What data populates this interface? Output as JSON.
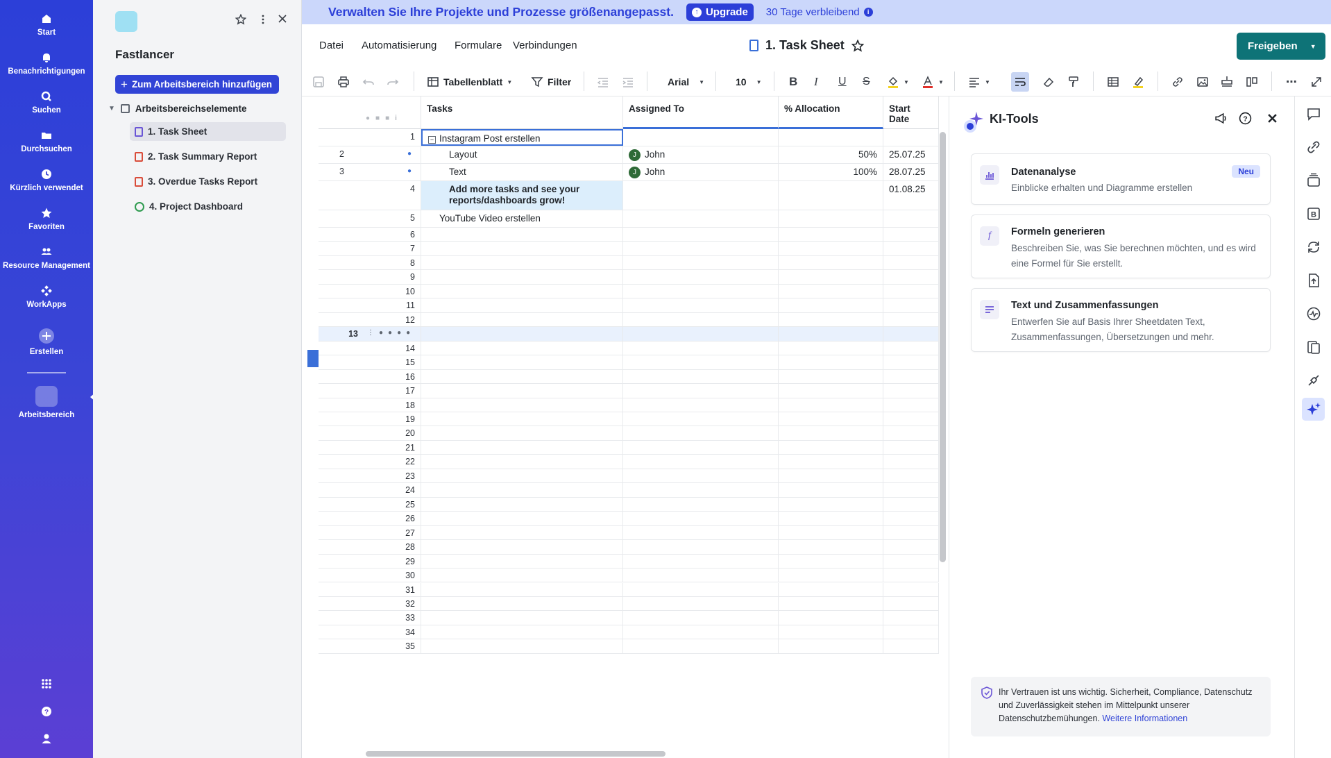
{
  "nav": {
    "items": [
      {
        "label": "Start",
        "icon": "home-icon"
      },
      {
        "label": "Benachrichtigungen",
        "icon": "bell-icon"
      },
      {
        "label": "Suchen",
        "icon": "search-icon"
      },
      {
        "label": "Durchsuchen",
        "icon": "folder-icon"
      },
      {
        "label": "Kürzlich verwendet",
        "icon": "clock-icon"
      },
      {
        "label": "Favoriten",
        "icon": "star-icon"
      },
      {
        "label": "Resource Management",
        "icon": "people-icon"
      },
      {
        "label": "WorkApps",
        "icon": "workapps-icon"
      },
      {
        "label": "Erstellen",
        "icon": "plus-circle-icon"
      }
    ],
    "workspace_label": "Arbeitsbereich"
  },
  "workspace": {
    "title": "Fastlancer",
    "add_button": "Zum Arbeitsbereich hinzufügen",
    "tree_head": "Arbeitsbereichselemente",
    "items": [
      {
        "label": "1. Task Sheet",
        "color": "#6a55d6"
      },
      {
        "label": "2. Task Summary Report",
        "color": "#d94c3a"
      },
      {
        "label": "3. Overdue Tasks Report",
        "color": "#d94c3a"
      },
      {
        "label": "4. Project Dashboard",
        "color": "#2e9b4f"
      }
    ]
  },
  "banner": {
    "text": "Verwalten Sie Ihre Projekte und Prozesse größenangepasst.",
    "upgrade": "Upgrade",
    "days": "30 Tage verbleibend"
  },
  "menu": {
    "items": [
      "Datei",
      "Automatisierung",
      "Formulare",
      "Verbindungen"
    ],
    "sheet_title": "1. Task Sheet",
    "share": "Freigeben"
  },
  "toolbar": {
    "view": "Tabellenblatt",
    "filter": "Filter",
    "font": "Arial",
    "size": "10"
  },
  "grid": {
    "columns": [
      "Tasks",
      "Assigned To",
      "% Allocation",
      "Start Date"
    ],
    "rows": [
      {
        "n": "1",
        "task": "Instagram Post erstellen",
        "assigned": "",
        "alloc": "",
        "start": ""
      },
      {
        "n": "2",
        "task": "Layout",
        "assigned": "John",
        "alloc": "50%",
        "start": "25.07.25"
      },
      {
        "n": "3",
        "task": "Text",
        "assigned": "John",
        "alloc": "100%",
        "start": "28.07.25"
      },
      {
        "n": "4",
        "task": "Add more tasks and see your reports/dashboards grow!",
        "assigned": "",
        "alloc": "",
        "start": "01.08.25"
      },
      {
        "n": "5",
        "task": "YouTube Video erstellen",
        "assigned": "",
        "alloc": "",
        "start": ""
      }
    ],
    "avatar_initial": "J",
    "empty_rows": [
      "6",
      "7",
      "8",
      "9",
      "10",
      "11",
      "12",
      "13",
      "14",
      "15",
      "16",
      "17",
      "18",
      "19",
      "20",
      "21",
      "22",
      "23",
      "24",
      "25",
      "26",
      "27",
      "28",
      "29",
      "30",
      "31",
      "32",
      "33",
      "34",
      "35"
    ]
  },
  "ai": {
    "title": "KI-Tools",
    "cards": [
      {
        "title": "Datenanalyse",
        "desc": "Einblicke erhalten und Diagramme erstellen",
        "badge": "Neu"
      },
      {
        "title": "Formeln generieren",
        "desc": "Beschreiben Sie, was Sie berechnen möchten, und es wird eine Formel für Sie erstellt."
      },
      {
        "title": "Text und Zusammenfassungen",
        "desc": "Entwerfen Sie auf Basis Ihrer Sheetdaten Text, Zusammenfassungen, Übersetzungen und mehr."
      }
    ],
    "trust_text": "Ihr Vertrauen ist uns wichtig. Sicherheit, Compliance, Datenschutz und Zuverlässigkeit stehen im Mittelpunkt unserer Datenschutzbemühungen.",
    "trust_link": "Weitere Informationen"
  }
}
